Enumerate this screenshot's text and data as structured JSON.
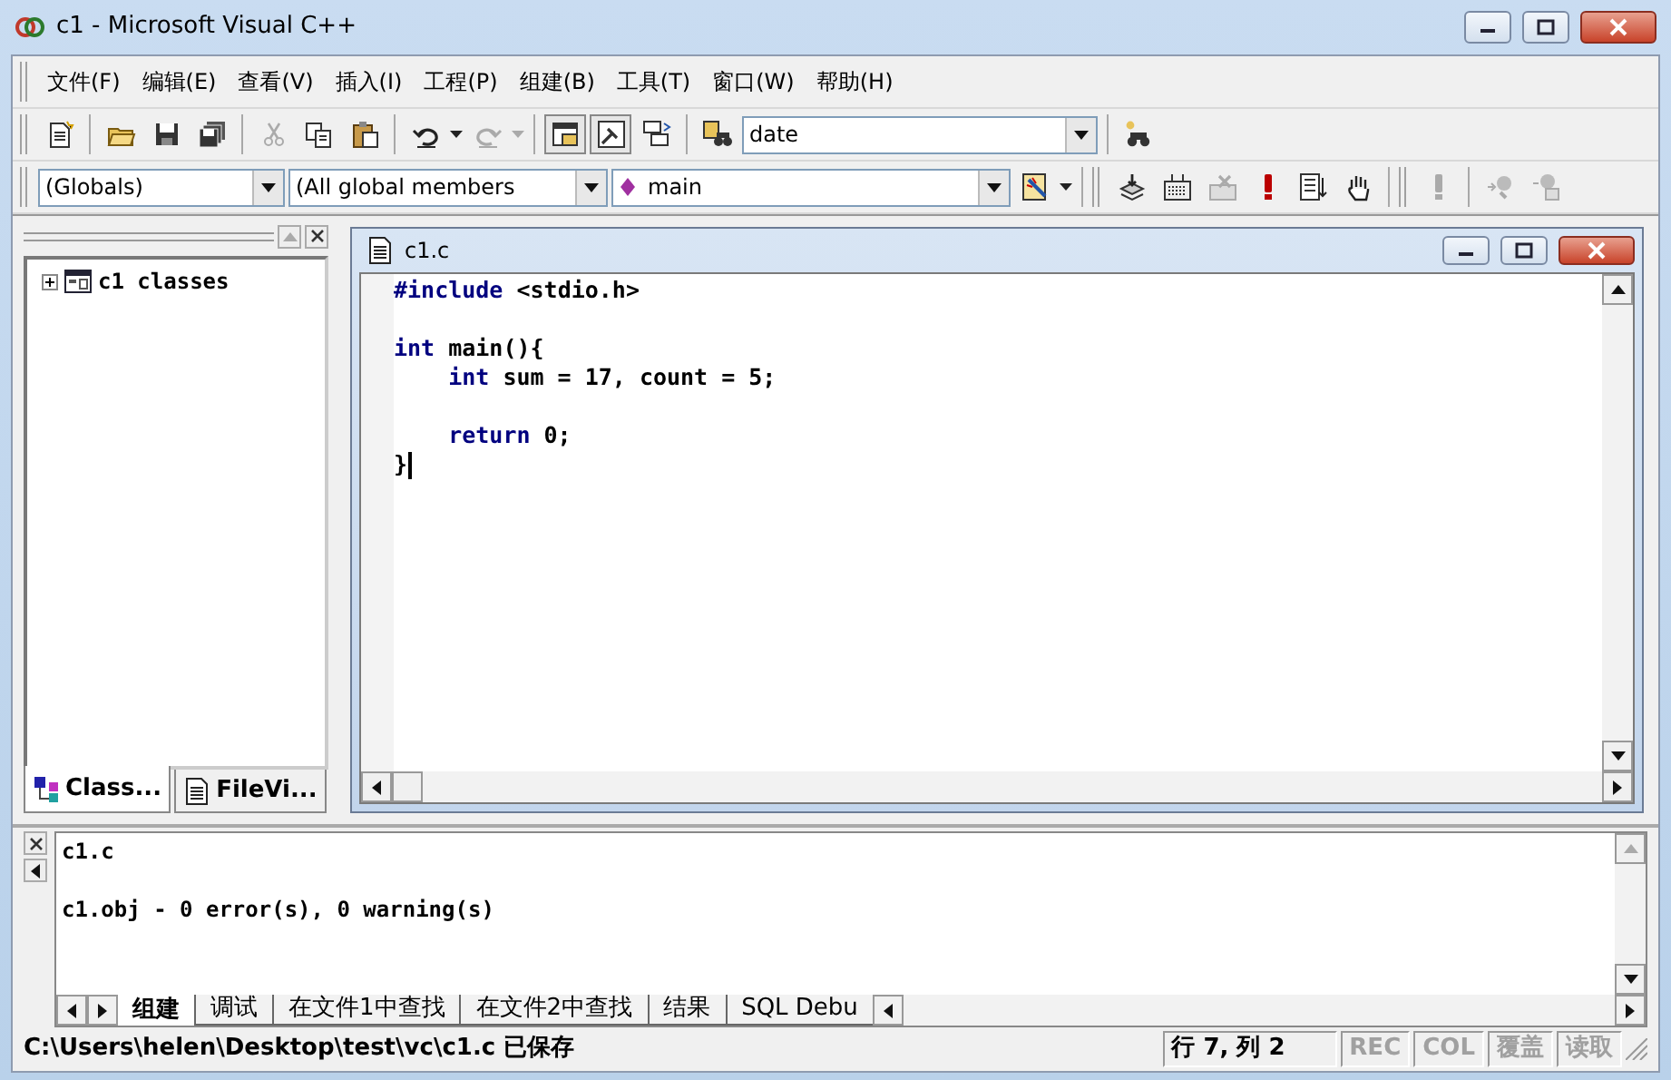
{
  "window": {
    "title": "c1 - Microsoft Visual C++"
  },
  "menu": [
    "文件(F)",
    "编辑(E)",
    "查看(V)",
    "插入(I)",
    "工程(P)",
    "组建(B)",
    "工具(T)",
    "窗口(W)",
    "帮助(H)"
  ],
  "toolbar": {
    "find_value": "date"
  },
  "wizard_bar": {
    "class": "(Globals)",
    "members": "(All global members",
    "function": "main"
  },
  "workspace": {
    "tree": [
      {
        "label": "c1 classes",
        "expanded": false
      }
    ],
    "tabs": [
      {
        "label": "Class...",
        "selected": true
      },
      {
        "label": "FileVi...",
        "selected": false
      }
    ]
  },
  "editor": {
    "title": "c1.c",
    "lines": [
      {
        "kind": "code",
        "indent": false,
        "segments": [
          {
            "text": "#include",
            "keyword": true
          },
          {
            "text": " <stdio.h>",
            "keyword": false
          }
        ]
      },
      {
        "kind": "blank"
      },
      {
        "kind": "code",
        "indent": false,
        "segments": [
          {
            "text": "int",
            "keyword": true
          },
          {
            "text": " main(){",
            "keyword": false
          }
        ]
      },
      {
        "kind": "code",
        "indent": true,
        "segments": [
          {
            "text": "int",
            "keyword": true
          },
          {
            "text": " sum = 17, count = 5;",
            "keyword": false
          }
        ]
      },
      {
        "kind": "blank"
      },
      {
        "kind": "code",
        "indent": true,
        "segments": [
          {
            "text": "return",
            "keyword": true
          },
          {
            "text": " 0;",
            "keyword": false
          }
        ]
      },
      {
        "kind": "code",
        "indent": false,
        "caret": true,
        "segments": [
          {
            "text": "}",
            "keyword": false
          }
        ]
      }
    ]
  },
  "output": {
    "lines": [
      {
        "kind": "text",
        "text": "c1.c"
      },
      {
        "kind": "blank"
      },
      {
        "kind": "text",
        "text": "c1.obj - 0 error(s), 0 warning(s)"
      }
    ],
    "tabs": [
      {
        "label": "组建",
        "selected": true
      },
      {
        "label": "调试",
        "selected": false
      },
      {
        "label": "在文件1中查找",
        "selected": false
      },
      {
        "label": "在文件2中查找",
        "selected": false
      },
      {
        "label": "结果",
        "selected": false
      },
      {
        "label": "SQL Debu",
        "selected": false
      }
    ]
  },
  "status_bar": {
    "message": "C:\\Users\\helen\\Desktop\\test\\vc\\c1.c 已保存",
    "position": "行 7, 列 2",
    "indicators": [
      {
        "label": "REC",
        "on": false
      },
      {
        "label": "COL",
        "on": false
      },
      {
        "label": "覆盖",
        "on": false
      },
      {
        "label": "读取",
        "on": false
      }
    ]
  }
}
